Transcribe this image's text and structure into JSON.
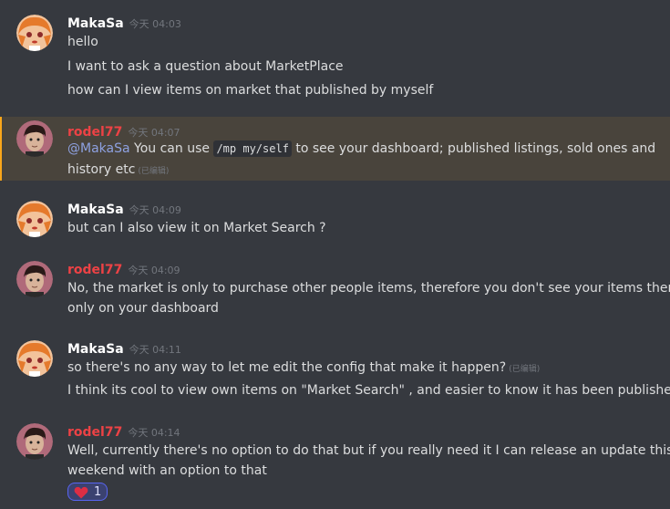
{
  "colors": {
    "background": "#36393f",
    "highlight": "#49443c",
    "highlight_bar": "#faa61a",
    "mention": "#8ea1e1",
    "username_red": "#ed4245"
  },
  "messages": [
    {
      "user": "MakaSa",
      "time": "今天 04:03",
      "lines": [
        "hello",
        "I want to ask a question about MarketPlace",
        "how can I view items on market that published by myself"
      ]
    },
    {
      "user": "rodel77",
      "time": "今天 04:07",
      "highlighted": true,
      "mention": "@MakaSa",
      "text_before_code": " You can use ",
      "code": "/mp my/self",
      "text_after_code": " to see your dashboard; published listings, sold ones and",
      "line2": "history etc",
      "edited": "(已编辑)"
    },
    {
      "user": "MakaSa",
      "time": "今天 04:09",
      "lines": [
        "but can I also view it on Market Search ?"
      ]
    },
    {
      "user": "rodel77",
      "time": "今天 04:09",
      "lines": [
        "No, the market is only to purchase other people items, therefore you don't see your items there,",
        "only on your dashboard"
      ]
    },
    {
      "user": "MakaSa",
      "time": "今天 04:11",
      "line1": "so there's no any way to let me edit the config that make it happen?",
      "edited": "(已编辑)",
      "line2": "I think its cool to view own items on \"Market Search\" , and easier to know it has been published"
    },
    {
      "user": "rodel77",
      "time": "今天 04:14",
      "lines": [
        "Well, currently there's no option to do that but if you really need it I can release an update this",
        "weekend with an option to that"
      ],
      "reaction": {
        "emoji": "heart-icon",
        "count": "1"
      }
    }
  ]
}
